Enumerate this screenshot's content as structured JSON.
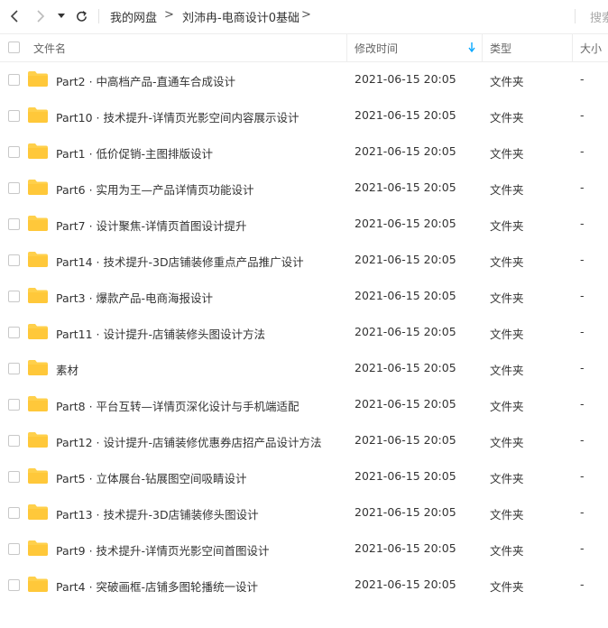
{
  "toolbar": {
    "breadcrumb": [
      "我的网盘",
      "刘沛冉-电商设计0基础"
    ],
    "search_label": "搜索"
  },
  "header": {
    "name": "文件名",
    "modified": "修改时间",
    "type": "类型",
    "size": "大小"
  },
  "colors": {
    "folder": "#FFD04B",
    "sort_arrow": "#06a7ff"
  },
  "files": [
    {
      "name": "Part2 · 中高档产品-直通车合成设计",
      "date": "2021-06-15 20:05",
      "type": "文件夹",
      "size": "-"
    },
    {
      "name": "Part10 · 技术提升-详情页光影空间内容展示设计",
      "date": "2021-06-15 20:05",
      "type": "文件夹",
      "size": "-"
    },
    {
      "name": "Part1 · 低价促销-主图排版设计",
      "date": "2021-06-15 20:05",
      "type": "文件夹",
      "size": "-"
    },
    {
      "name": "Part6 · 实用为王—产品详情页功能设计",
      "date": "2021-06-15 20:05",
      "type": "文件夹",
      "size": "-"
    },
    {
      "name": "Part7 · 设计聚焦-详情页首图设计提升",
      "date": "2021-06-15 20:05",
      "type": "文件夹",
      "size": "-"
    },
    {
      "name": "Part14 · 技术提升-3D店铺装修重点产品推广设计",
      "date": "2021-06-15 20:05",
      "type": "文件夹",
      "size": "-"
    },
    {
      "name": "Part3 · 爆款产品-电商海报设计",
      "date": "2021-06-15 20:05",
      "type": "文件夹",
      "size": "-"
    },
    {
      "name": "Part11 · 设计提升-店铺装修头图设计方法",
      "date": "2021-06-15 20:05",
      "type": "文件夹",
      "size": "-"
    },
    {
      "name": "素材",
      "date": "2021-06-15 20:05",
      "type": "文件夹",
      "size": "-"
    },
    {
      "name": "Part8 · 平台互转—详情页深化设计与手机端适配",
      "date": "2021-06-15 20:05",
      "type": "文件夹",
      "size": "-"
    },
    {
      "name": "Part12 · 设计提升-店铺装修优惠券店招产品设计方法",
      "date": "2021-06-15 20:05",
      "type": "文件夹",
      "size": "-"
    },
    {
      "name": "Part5 · 立体展台-钻展图空间吸睛设计",
      "date": "2021-06-15 20:05",
      "type": "文件夹",
      "size": "-"
    },
    {
      "name": "Part13 · 技术提升-3D店铺装修头图设计",
      "date": "2021-06-15 20:05",
      "type": "文件夹",
      "size": "-"
    },
    {
      "name": "Part9 · 技术提升-详情页光影空间首图设计",
      "date": "2021-06-15 20:05",
      "type": "文件夹",
      "size": "-"
    },
    {
      "name": "Part4 · 突破画框-店铺多图轮播统一设计",
      "date": "2021-06-15 20:05",
      "type": "文件夹",
      "size": "-"
    }
  ]
}
